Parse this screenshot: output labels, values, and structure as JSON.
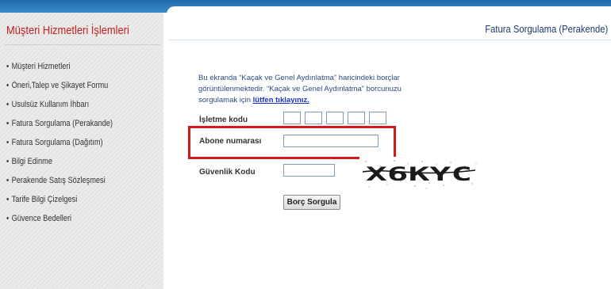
{
  "sidebar": {
    "title": "Müşteri Hizmetleri İşlemleri",
    "items": [
      {
        "label": "Müşteri Hizmetleri"
      },
      {
        "label": "Öneri,Talep ve Şikayet Formu"
      },
      {
        "label": "Usulsüz Kullanım İhbarı"
      },
      {
        "label": "Fatura Sorgulama (Perakande)"
      },
      {
        "label": "Fatura Sorgulama (Dağıtım)"
      },
      {
        "label": "Bilgi Edinme"
      },
      {
        "label": "Perakende Satış Sözleşmesi"
      },
      {
        "label": "Tarife Bilgi Çizelgesi"
      },
      {
        "label": "Güvence Bedelleri"
      }
    ]
  },
  "header": {
    "title": "Fatura Sorgulama (Perakende)"
  },
  "info": {
    "text_before": "Bu ekranda “Kaçak ve Genel Aydınlatma” haricindeki borçlar görüntülenmektedir. “Kaçak ve Genel Aydınlatma” borcunuzu sorgulamak için ",
    "link_text": "lütfen tıklayınız."
  },
  "form": {
    "isletme_label": "İşletme kodu",
    "abone_label": "Abone numarası",
    "guvenlik_label": "Güvenlik Kodu",
    "captcha_text": "X6KYC",
    "submit_label": "Borç Sorgula"
  }
}
